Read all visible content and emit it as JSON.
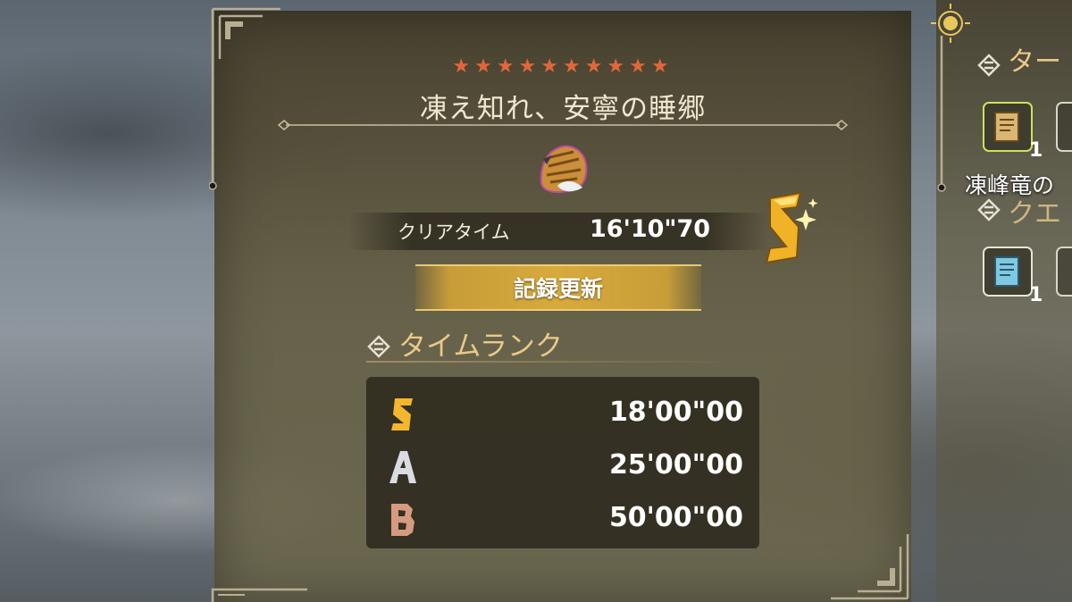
{
  "quest": {
    "stars": "★★★★★★★★★★",
    "title": "凍え知れ、安寧の睡郷",
    "clear_label": "クリアタイム",
    "clear_time": "16'10\"70",
    "achieved_rank": "S",
    "record_label": "記録更新"
  },
  "time_rank": {
    "header": "タイムランク",
    "rows": [
      {
        "rank": "S",
        "time": "18'00\"00",
        "color": "#f3b62e"
      },
      {
        "rank": "A",
        "time": "25'00\"00",
        "color": "#d9dde2"
      },
      {
        "rank": "B",
        "time": "50'00\"00",
        "color": "#d59a80"
      }
    ]
  },
  "side_panel": {
    "title_top": "ター",
    "title_bottom": "クエ",
    "reward_label": "凍峰竜の",
    "item1_count": "1",
    "item2_count": "1"
  },
  "colors": {
    "star": "#e0673c",
    "gold_accent": "#e9c98a",
    "record_band": "#d7aa3c"
  }
}
